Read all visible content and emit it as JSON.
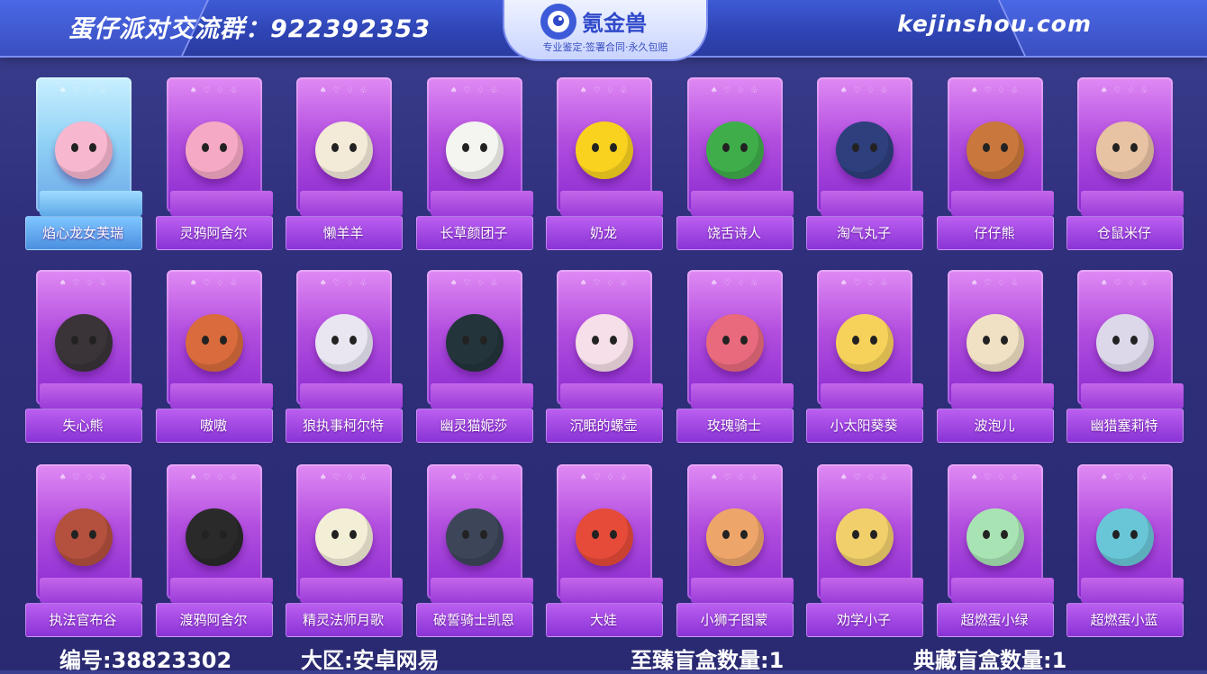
{
  "header": {
    "group_text": "蛋仔派对交流群：922392353",
    "logo_name": "氪金兽",
    "logo_slogan": "专业鉴定·签署合同·永久包赔",
    "site": "kejinshou.com"
  },
  "suits": "♠ ♡ ♢ ♧",
  "cards": [
    {
      "label": "焰心龙女芙瑞",
      "color": "#f7b7cf",
      "special": true
    },
    {
      "label": "灵鸦阿舍尔",
      "color": "#f6a9c4"
    },
    {
      "label": "懒羊羊",
      "color": "#f3ead8"
    },
    {
      "label": "长草颜团子",
      "color": "#f4f4f0"
    },
    {
      "label": "奶龙",
      "color": "#f8d21f"
    },
    {
      "label": "饶舌诗人",
      "color": "#3fae4a"
    },
    {
      "label": "淘气丸子",
      "color": "#2e3f7d"
    },
    {
      "label": "仔仔熊",
      "color": "#c9773c"
    },
    {
      "label": "仓鼠米仔",
      "color": "#e7c2a3"
    },
    {
      "label": "失心熊",
      "color": "#3a3438"
    },
    {
      "label": "嗷嗷",
      "color": "#d96b3d"
    },
    {
      "label": "狼执事柯尔特",
      "color": "#e9e6f2"
    },
    {
      "label": "幽灵猫妮莎",
      "color": "#23353b"
    },
    {
      "label": "沉眠的螺壶",
      "color": "#f6dfe8"
    },
    {
      "label": "玫瑰骑士",
      "color": "#e86a7c"
    },
    {
      "label": "小太阳葵葵",
      "color": "#f6d25a"
    },
    {
      "label": "波泡儿",
      "color": "#f1e1c4"
    },
    {
      "label": "幽猎塞莉特",
      "color": "#dcd8ea"
    },
    {
      "label": "执法官布谷",
      "color": "#b3503e"
    },
    {
      "label": "渡鸦阿舍尔",
      "color": "#2a2a2a"
    },
    {
      "label": "精灵法师月歌",
      "color": "#f3eed6"
    },
    {
      "label": "破誓骑士凯恩",
      "color": "#3c4658"
    },
    {
      "label": "大娃",
      "color": "#e64b3a"
    },
    {
      "label": "小狮子图蒙",
      "color": "#eea56a"
    },
    {
      "label": "劝学小子",
      "color": "#f1d06c"
    },
    {
      "label": "超燃蛋小绿",
      "color": "#a8e3b4"
    },
    {
      "label": "超燃蛋小蓝",
      "color": "#69c6d7"
    }
  ],
  "footer": {
    "id_label": "编号:38823302",
    "region_label": "大区:安卓网易",
    "supreme_box": "至臻盲盒数量:1",
    "classic_box": "典藏盲盒数量:1"
  }
}
